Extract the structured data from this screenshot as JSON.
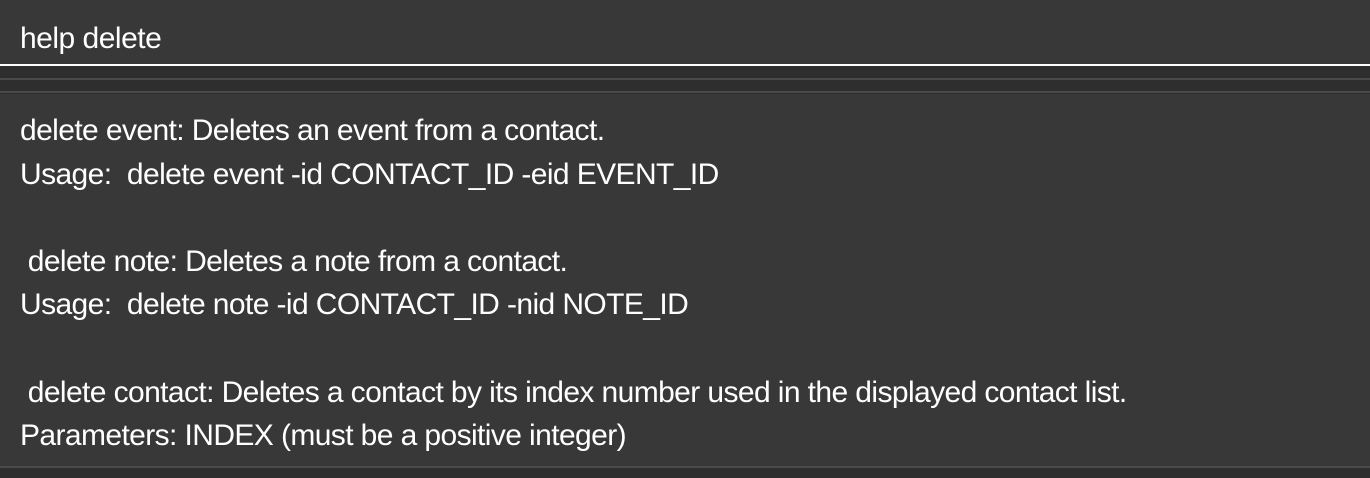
{
  "command_box": {
    "value": "help delete"
  },
  "result_display": {
    "lines": [
      "delete event: Deletes an event from a contact.",
      "Usage:  delete event -id CONTACT_ID -eid EVENT_ID",
      "",
      " delete note: Deletes a note from a contact.",
      "Usage:  delete note -id CONTACT_ID -nid NOTE_ID",
      "",
      " delete contact: Deletes a contact by its index number used in the displayed contact list.",
      "Parameters: INDEX (must be a positive integer)"
    ]
  },
  "colors": {
    "background": "#333333",
    "panel": "#383838",
    "text": "#ffffff",
    "divider": "#4a4a4a"
  }
}
